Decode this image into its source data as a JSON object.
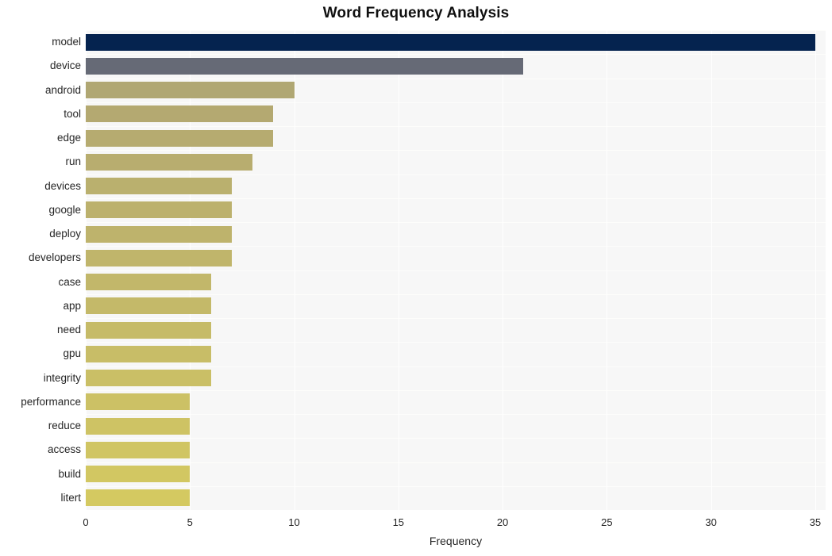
{
  "chart_data": {
    "type": "bar",
    "orientation": "horizontal",
    "title": "Word Frequency Analysis",
    "xlabel": "Frequency",
    "ylabel": "",
    "xlim": [
      0,
      35.5
    ],
    "xticks": [
      0,
      5,
      10,
      15,
      20,
      25,
      30,
      35
    ],
    "xtick_labels": [
      "0",
      "5",
      "10",
      "15",
      "20",
      "25",
      "30",
      "35"
    ],
    "grid": true,
    "grid_axis": "both",
    "legend": false,
    "plot_background": "#f7f7f7",
    "figure_background": "#ffffff",
    "categories": [
      "model",
      "device",
      "android",
      "tool",
      "edge",
      "run",
      "devices",
      "google",
      "deploy",
      "developers",
      "case",
      "app",
      "need",
      "gpu",
      "integrity",
      "performance",
      "reduce",
      "access",
      "build",
      "litert"
    ],
    "values": [
      35,
      21,
      10,
      9,
      9,
      8,
      7,
      7,
      7,
      7,
      6,
      6,
      6,
      6,
      6,
      5,
      5,
      5,
      5,
      5
    ],
    "bar_colors": [
      "#05234f",
      "#666a76",
      "#b0a773",
      "#b4a971",
      "#b6ab70",
      "#b8ad6f",
      "#bab06e",
      "#bcb16d",
      "#beb36c",
      "#c0b56b",
      "#c2b76a",
      "#c4b969",
      "#c6bb68",
      "#c8bd67",
      "#cabf66",
      "#ccc165",
      "#cec364",
      "#d0c563",
      "#d2c762",
      "#d4c961"
    ]
  }
}
